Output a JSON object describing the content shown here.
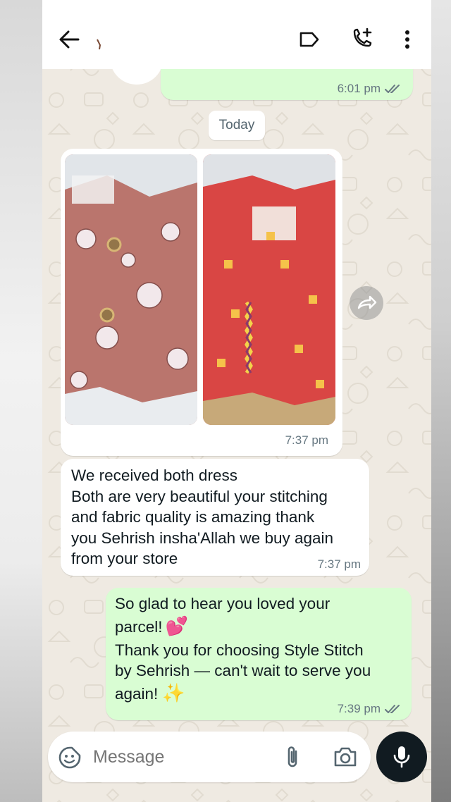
{
  "header": {
    "back_icon": "arrow-left-icon",
    "label_icon": "label-tag-icon",
    "call_icon": "add-call-icon",
    "menu_icon": "more-vertical-icon"
  },
  "messages": {
    "first_out": {
      "time": "6:01 pm",
      "status": "read"
    },
    "date_divider": "Today",
    "image_message": {
      "time": "7:37 pm",
      "image_count": 2
    },
    "incoming_text": {
      "text": "We received both dress\nBoth are very beautiful your stitching\nand fabric quality is amazing thank\nyou Sehrish insha'Allah we buy again\nfrom your store",
      "time": "7:37 pm"
    },
    "outgoing_text": {
      "line1": "So glad to hear you loved your",
      "line2": "parcel!",
      "emoji1": "💕",
      "line3": "Thank you for choosing Style Stitch",
      "line4": "by Sehrish — can't wait to serve you",
      "line5": "again!",
      "emoji2": "✨",
      "time": "7:39 pm",
      "status": "read"
    }
  },
  "composer": {
    "placeholder": "Message",
    "sticker_icon": "sticker-smiley-icon",
    "attach_icon": "paperclip-icon",
    "camera_icon": "camera-icon",
    "mic_icon": "microphone-icon"
  },
  "colors": {
    "outgoing_bubble": "#d9fdd3",
    "incoming_bubble": "#ffffff",
    "chat_background": "#efeae2",
    "read_ticks": "#667781",
    "mic_button": "#111b21"
  }
}
